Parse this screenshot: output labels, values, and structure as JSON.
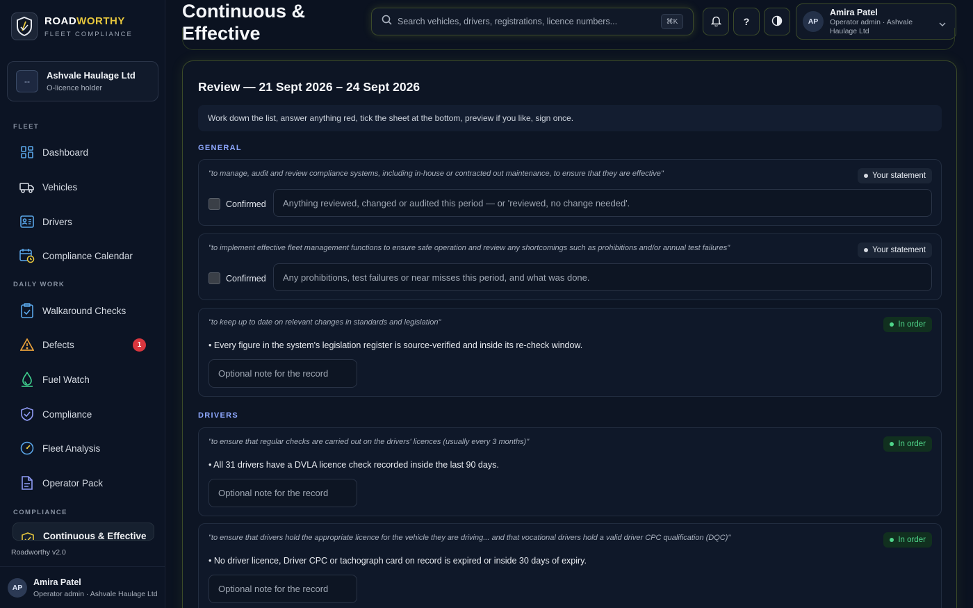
{
  "brand": {
    "name_main": "ROAD",
    "name_accent": "WORTHY",
    "subtitle": "FLEET COMPLIANCE"
  },
  "org": {
    "avatar": "--",
    "name": "Ashvale Haulage Ltd",
    "role": "O-licence holder"
  },
  "sidebar": {
    "sections": [
      "FLEET",
      "DAILY WORK",
      "COMPLIANCE"
    ],
    "items": [
      {
        "label": "Dashboard",
        "icon": "dashboard-grid-icon"
      },
      {
        "label": "Vehicles",
        "icon": "truck-icon"
      },
      {
        "label": "Drivers",
        "icon": "id-card-icon"
      },
      {
        "label": "Compliance Calendar",
        "icon": "calendar-clock-icon"
      },
      {
        "label": "Walkaround Checks",
        "icon": "clipboard-check-icon"
      },
      {
        "label": "Defects",
        "icon": "warning-triangle-icon",
        "badge": "1"
      },
      {
        "label": "Fuel Watch",
        "icon": "fuel-drop-icon"
      },
      {
        "label": "Compliance",
        "icon": "shield-check-icon"
      },
      {
        "label": "Fleet Analysis",
        "icon": "gauge-icon"
      },
      {
        "label": "Operator Pack",
        "icon": "document-icon"
      },
      {
        "label": "Continuous & Effective",
        "icon": "shield-badge-icon",
        "active": true
      }
    ],
    "version": "Roadworthy v2.0",
    "footer": {
      "initials": "AP",
      "name": "Amira Patel",
      "role": "Operator admin · Ashvale Haulage Ltd"
    }
  },
  "header": {
    "title": "Continuous & Effective",
    "search_placeholder": "Search vehicles, drivers, registrations, licence numbers...",
    "search_shortcut": "⌘K",
    "help_label": "?",
    "user": {
      "initials": "AP",
      "name": "Amira Patel",
      "role": "Operator admin · Ashvale Haulage Ltd"
    }
  },
  "review": {
    "title": "Review — 21 Sept 2026 – 24 Sept 2026",
    "instructions": "Work down the list, answer anything red, tick the sheet at the bottom, preview if you like, sign once.",
    "sections": [
      {
        "heading": "GENERAL",
        "items": [
          {
            "quote": "\"to manage, audit and review compliance systems, including in-house or contracted out maintenance, to ensure that they are effective\"",
            "status": "Your statement",
            "confirm_label": "Confirmed",
            "placeholder": "Anything reviewed, changed or audited this period — or 'reviewed, no change needed'."
          },
          {
            "quote": "\"to implement effective fleet management functions to ensure safe operation and review any shortcomings such as prohibitions and/or annual test failures\"",
            "status": "Your statement",
            "confirm_label": "Confirmed",
            "placeholder": "Any prohibitions, test failures or near misses this period, and what was done."
          },
          {
            "quote": "\"to keep up to date on relevant changes in standards and legislation\"",
            "status": "In order",
            "finding": "• Every figure in the system's legislation register is source-verified and inside its re-check window.",
            "placeholder": "Optional note for the record"
          }
        ]
      },
      {
        "heading": "DRIVERS",
        "items": [
          {
            "quote": "\"to ensure that regular checks are carried out on the drivers' licences (usually every 3 months)\"",
            "status": "In order",
            "finding": "• All 31 drivers have a DVLA licence check recorded inside the last 90 days.",
            "placeholder": "Optional note for the record"
          },
          {
            "quote": "\"to ensure that drivers hold the appropriate licence for the vehicle they are driving... and that vocational drivers hold a valid driver CPC qualification (DQC)\"",
            "status": "In order",
            "finding": "• No driver licence, Driver CPC or tachograph card on record is expired or inside 30 days of expiry.",
            "placeholder": "Optional note for the record"
          }
        ]
      }
    ]
  },
  "colors": {
    "accent": "#e7c73d",
    "ok": "#4fd58a",
    "section": "#8ea8ff",
    "badge": "#d9363e"
  }
}
